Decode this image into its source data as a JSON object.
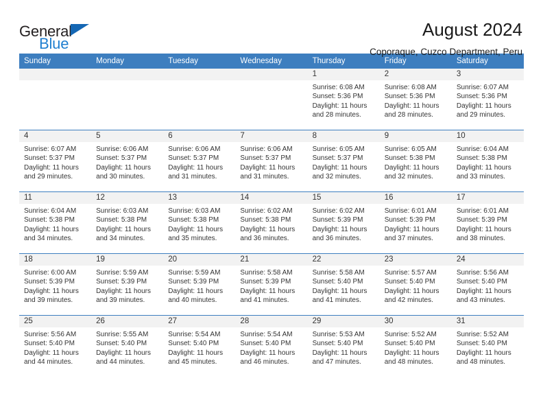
{
  "brand": {
    "name_dark": "General",
    "name_blue": "Blue",
    "accent_color": "#1567b4",
    "accent_color_light": "#1f7fd0"
  },
  "header": {
    "title": "August 2024",
    "subtitle": "Coporaque, Cuzco Department, Peru"
  },
  "calendar": {
    "header_bg": "#3d7ebf",
    "daynum_bg": "#f2f2f2",
    "weekdays": [
      "Sunday",
      "Monday",
      "Tuesday",
      "Wednesday",
      "Thursday",
      "Friday",
      "Saturday"
    ],
    "weeks": [
      [
        {
          "day": "",
          "lines": []
        },
        {
          "day": "",
          "lines": []
        },
        {
          "day": "",
          "lines": []
        },
        {
          "day": "",
          "lines": []
        },
        {
          "day": "1",
          "lines": [
            "Sunrise: 6:08 AM",
            "Sunset: 5:36 PM",
            "Daylight: 11 hours",
            "and 28 minutes."
          ]
        },
        {
          "day": "2",
          "lines": [
            "Sunrise: 6:08 AM",
            "Sunset: 5:36 PM",
            "Daylight: 11 hours",
            "and 28 minutes."
          ]
        },
        {
          "day": "3",
          "lines": [
            "Sunrise: 6:07 AM",
            "Sunset: 5:36 PM",
            "Daylight: 11 hours",
            "and 29 minutes."
          ]
        }
      ],
      [
        {
          "day": "4",
          "lines": [
            "Sunrise: 6:07 AM",
            "Sunset: 5:37 PM",
            "Daylight: 11 hours",
            "and 29 minutes."
          ]
        },
        {
          "day": "5",
          "lines": [
            "Sunrise: 6:06 AM",
            "Sunset: 5:37 PM",
            "Daylight: 11 hours",
            "and 30 minutes."
          ]
        },
        {
          "day": "6",
          "lines": [
            "Sunrise: 6:06 AM",
            "Sunset: 5:37 PM",
            "Daylight: 11 hours",
            "and 31 minutes."
          ]
        },
        {
          "day": "7",
          "lines": [
            "Sunrise: 6:06 AM",
            "Sunset: 5:37 PM",
            "Daylight: 11 hours",
            "and 31 minutes."
          ]
        },
        {
          "day": "8",
          "lines": [
            "Sunrise: 6:05 AM",
            "Sunset: 5:37 PM",
            "Daylight: 11 hours",
            "and 32 minutes."
          ]
        },
        {
          "day": "9",
          "lines": [
            "Sunrise: 6:05 AM",
            "Sunset: 5:38 PM",
            "Daylight: 11 hours",
            "and 32 minutes."
          ]
        },
        {
          "day": "10",
          "lines": [
            "Sunrise: 6:04 AM",
            "Sunset: 5:38 PM",
            "Daylight: 11 hours",
            "and 33 minutes."
          ]
        }
      ],
      [
        {
          "day": "11",
          "lines": [
            "Sunrise: 6:04 AM",
            "Sunset: 5:38 PM",
            "Daylight: 11 hours",
            "and 34 minutes."
          ]
        },
        {
          "day": "12",
          "lines": [
            "Sunrise: 6:03 AM",
            "Sunset: 5:38 PM",
            "Daylight: 11 hours",
            "and 34 minutes."
          ]
        },
        {
          "day": "13",
          "lines": [
            "Sunrise: 6:03 AM",
            "Sunset: 5:38 PM",
            "Daylight: 11 hours",
            "and 35 minutes."
          ]
        },
        {
          "day": "14",
          "lines": [
            "Sunrise: 6:02 AM",
            "Sunset: 5:38 PM",
            "Daylight: 11 hours",
            "and 36 minutes."
          ]
        },
        {
          "day": "15",
          "lines": [
            "Sunrise: 6:02 AM",
            "Sunset: 5:39 PM",
            "Daylight: 11 hours",
            "and 36 minutes."
          ]
        },
        {
          "day": "16",
          "lines": [
            "Sunrise: 6:01 AM",
            "Sunset: 5:39 PM",
            "Daylight: 11 hours",
            "and 37 minutes."
          ]
        },
        {
          "day": "17",
          "lines": [
            "Sunrise: 6:01 AM",
            "Sunset: 5:39 PM",
            "Daylight: 11 hours",
            "and 38 minutes."
          ]
        }
      ],
      [
        {
          "day": "18",
          "lines": [
            "Sunrise: 6:00 AM",
            "Sunset: 5:39 PM",
            "Daylight: 11 hours",
            "and 39 minutes."
          ]
        },
        {
          "day": "19",
          "lines": [
            "Sunrise: 5:59 AM",
            "Sunset: 5:39 PM",
            "Daylight: 11 hours",
            "and 39 minutes."
          ]
        },
        {
          "day": "20",
          "lines": [
            "Sunrise: 5:59 AM",
            "Sunset: 5:39 PM",
            "Daylight: 11 hours",
            "and 40 minutes."
          ]
        },
        {
          "day": "21",
          "lines": [
            "Sunrise: 5:58 AM",
            "Sunset: 5:39 PM",
            "Daylight: 11 hours",
            "and 41 minutes."
          ]
        },
        {
          "day": "22",
          "lines": [
            "Sunrise: 5:58 AM",
            "Sunset: 5:40 PM",
            "Daylight: 11 hours",
            "and 41 minutes."
          ]
        },
        {
          "day": "23",
          "lines": [
            "Sunrise: 5:57 AM",
            "Sunset: 5:40 PM",
            "Daylight: 11 hours",
            "and 42 minutes."
          ]
        },
        {
          "day": "24",
          "lines": [
            "Sunrise: 5:56 AM",
            "Sunset: 5:40 PM",
            "Daylight: 11 hours",
            "and 43 minutes."
          ]
        }
      ],
      [
        {
          "day": "25",
          "lines": [
            "Sunrise: 5:56 AM",
            "Sunset: 5:40 PM",
            "Daylight: 11 hours",
            "and 44 minutes."
          ]
        },
        {
          "day": "26",
          "lines": [
            "Sunrise: 5:55 AM",
            "Sunset: 5:40 PM",
            "Daylight: 11 hours",
            "and 44 minutes."
          ]
        },
        {
          "day": "27",
          "lines": [
            "Sunrise: 5:54 AM",
            "Sunset: 5:40 PM",
            "Daylight: 11 hours",
            "and 45 minutes."
          ]
        },
        {
          "day": "28",
          "lines": [
            "Sunrise: 5:54 AM",
            "Sunset: 5:40 PM",
            "Daylight: 11 hours",
            "and 46 minutes."
          ]
        },
        {
          "day": "29",
          "lines": [
            "Sunrise: 5:53 AM",
            "Sunset: 5:40 PM",
            "Daylight: 11 hours",
            "and 47 minutes."
          ]
        },
        {
          "day": "30",
          "lines": [
            "Sunrise: 5:52 AM",
            "Sunset: 5:40 PM",
            "Daylight: 11 hours",
            "and 48 minutes."
          ]
        },
        {
          "day": "31",
          "lines": [
            "Sunrise: 5:52 AM",
            "Sunset: 5:40 PM",
            "Daylight: 11 hours",
            "and 48 minutes."
          ]
        }
      ]
    ]
  }
}
